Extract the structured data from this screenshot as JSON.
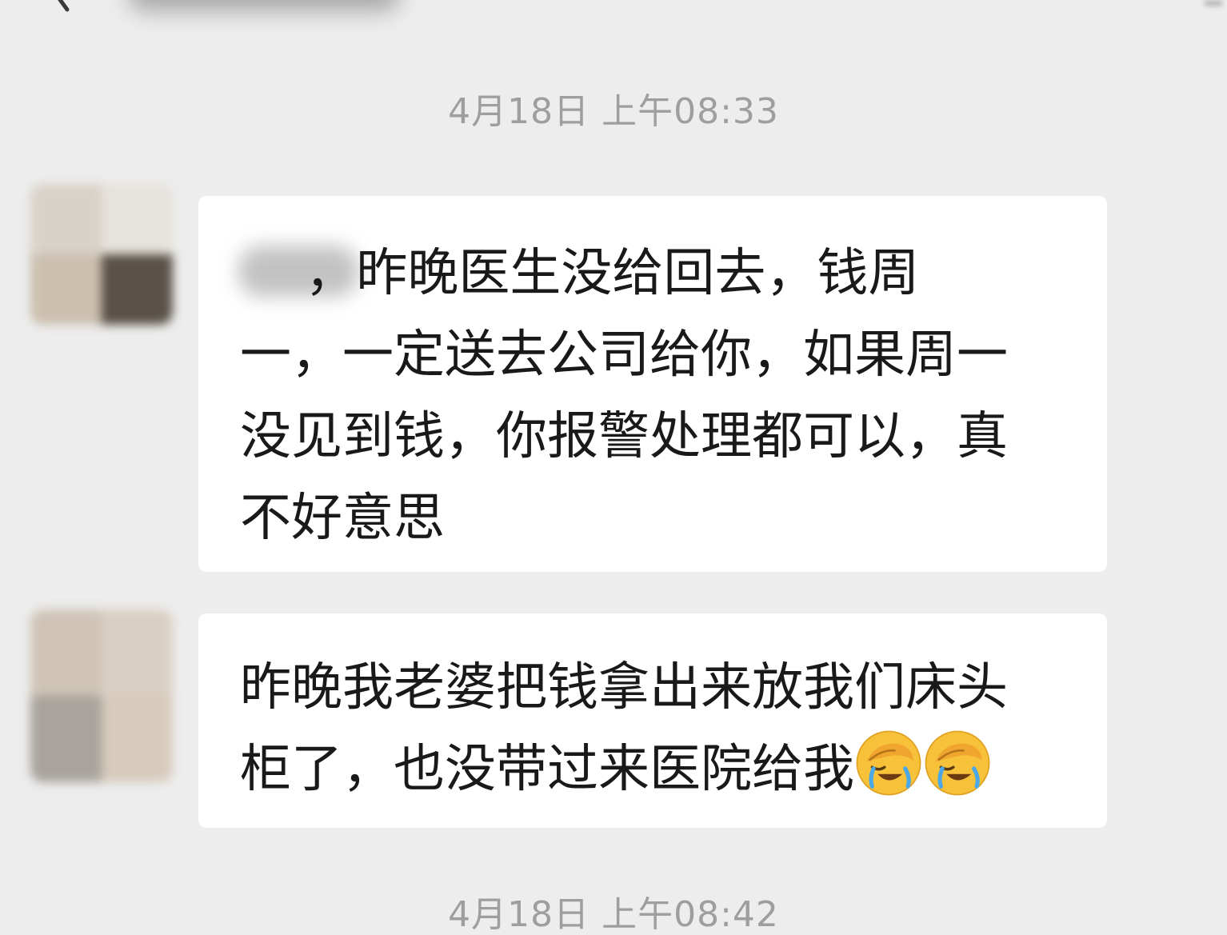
{
  "header": {
    "back_icon": "chevron-left-icon"
  },
  "timestamps": {
    "first": "4月18日 上午08:33",
    "second": "4月18日 上午08:42"
  },
  "messages": [
    {
      "sender": "",
      "lines": [
        "    ，昨晚医生没给回去，钱周",
        "一，一定送去公司给你，如果周一",
        "没见到钱，你报警处理都可以，真",
        "不好意思"
      ]
    },
    {
      "sender": "",
      "lines": [
        "昨晚我老婆把钱拿出来放我们床头",
        "柜了，也没带过来医院给我"
      ],
      "emojis": [
        "facepalm-emoji",
        "facepalm-emoji"
      ]
    }
  ],
  "colors": {
    "background": "#ededed",
    "bubble": "#ffffff",
    "timestamp": "#9e9e9e",
    "text": "#191919"
  }
}
